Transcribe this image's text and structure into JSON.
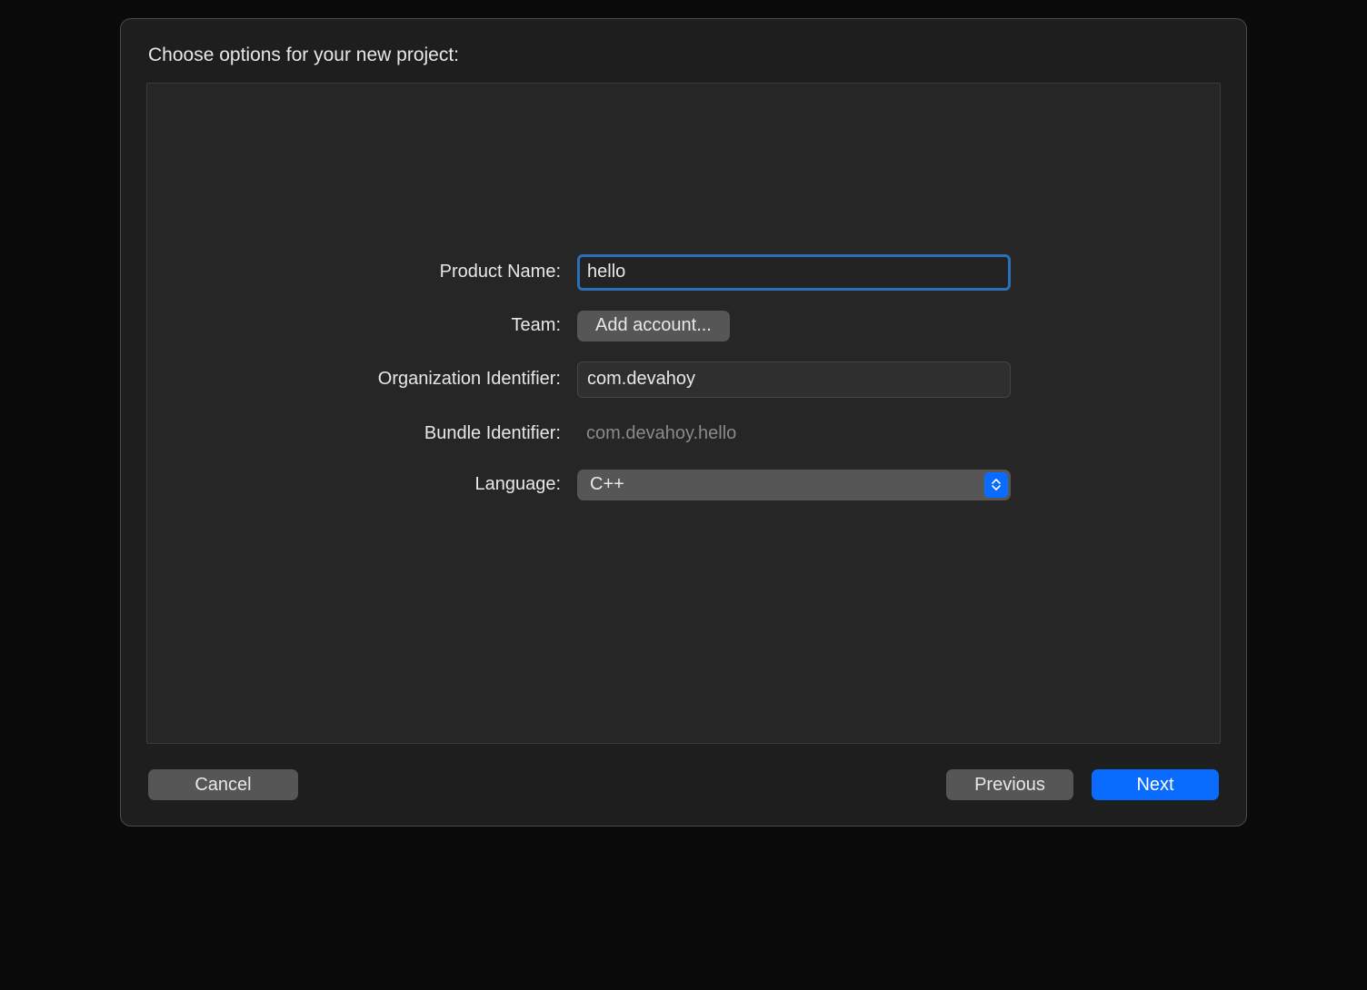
{
  "dialog": {
    "title": "Choose options for your new project:"
  },
  "form": {
    "product_name": {
      "label": "Product Name:",
      "value": "hello"
    },
    "team": {
      "label": "Team:",
      "button": "Add account..."
    },
    "org_identifier": {
      "label": "Organization Identifier:",
      "value": "com.devahoy"
    },
    "bundle_identifier": {
      "label": "Bundle Identifier:",
      "value": "com.devahoy.hello"
    },
    "language": {
      "label": "Language:",
      "value": "C++"
    }
  },
  "footer": {
    "cancel": "Cancel",
    "previous": "Previous",
    "next": "Next"
  }
}
